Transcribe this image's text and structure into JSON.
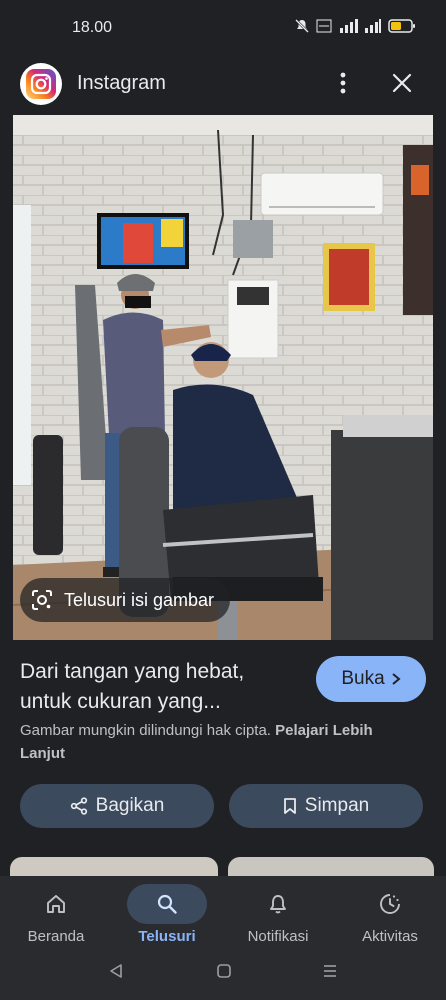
{
  "status_bar": {
    "time": "18.00"
  },
  "header": {
    "app_title": "Instagram"
  },
  "image": {
    "lens_label": "Telusuri isi gambar"
  },
  "result": {
    "title": "Dari tangan yang hebat, untuk cukuran yang...",
    "open_label": "Buka",
    "copyright_text": "Gambar mungkin dilindungi hak cipta.",
    "learn_more_label": "Pelajari Lebih Lanjut"
  },
  "actions": {
    "share_label": "Bagikan",
    "save_label": "Simpan"
  },
  "bottom_nav": {
    "items": [
      {
        "label": "Beranda",
        "icon": "home-icon"
      },
      {
        "label": "Telusuri",
        "icon": "search-icon",
        "active": true
      },
      {
        "label": "Notifikasi",
        "icon": "bell-icon"
      },
      {
        "label": "Aktivitas",
        "icon": "activity-icon"
      }
    ]
  },
  "colors": {
    "background": "#202124",
    "accent": "#8ab4f8",
    "chip": "#3c4a5e"
  }
}
